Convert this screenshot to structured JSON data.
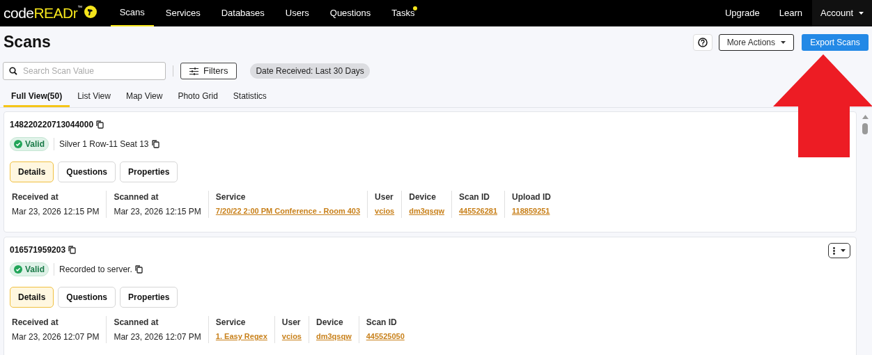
{
  "brand": {
    "name_plain": "code",
    "name_bold": "READr",
    "mark": "™"
  },
  "nav": [
    {
      "label": "Scans",
      "selected": true,
      "dot": false
    },
    {
      "label": "Services",
      "selected": false,
      "dot": false
    },
    {
      "label": "Databases",
      "selected": false,
      "dot": false
    },
    {
      "label": "Users",
      "selected": false,
      "dot": false
    },
    {
      "label": "Questions",
      "selected": false,
      "dot": false
    },
    {
      "label": "Tasks",
      "selected": false,
      "dot": true
    }
  ],
  "nav_right": [
    {
      "label": "Upgrade",
      "kind": "link"
    },
    {
      "label": "Learn",
      "kind": "link"
    },
    {
      "label": "Account",
      "kind": "menu"
    }
  ],
  "page_title": "Scans",
  "actions": {
    "more": "More Actions",
    "export": "Export Scans"
  },
  "search": {
    "placeholder": "Search Scan Value"
  },
  "filters_button": "Filters",
  "filter_chip": "Date Received: Last 30 Days",
  "view_tabs": [
    {
      "label": "Full View(50)",
      "selected": true
    },
    {
      "label": "List View",
      "selected": false
    },
    {
      "label": "Map View",
      "selected": false
    },
    {
      "label": "Photo Grid",
      "selected": false
    },
    {
      "label": "Statistics",
      "selected": false
    }
  ],
  "scans": [
    {
      "code": "148220220713044000",
      "status": "Valid",
      "value": "Silver 1 Row-11 Seat 13",
      "menu_visible": false,
      "tabs": [
        {
          "label": "Details",
          "selected": true
        },
        {
          "label": "Questions",
          "selected": false
        },
        {
          "label": "Properties",
          "selected": false
        }
      ],
      "fields": [
        {
          "label": "Received at",
          "value": "Mar 23, 2026 12:15 PM",
          "kind": "text"
        },
        {
          "label": "Scanned at",
          "value": "Mar 23, 2026 12:15 PM",
          "kind": "text"
        },
        {
          "label": "Service",
          "value": "7/20/22 2:00 PM Conference - Room 403",
          "kind": "link"
        },
        {
          "label": "User",
          "value": "vcios",
          "kind": "link"
        },
        {
          "label": "Device",
          "value": "dm3qsqw",
          "kind": "link"
        },
        {
          "label": "Scan ID",
          "value": "445526281",
          "kind": "link"
        },
        {
          "label": "Upload ID",
          "value": "118859251",
          "kind": "link"
        }
      ]
    },
    {
      "code": "016571959203",
      "status": "Valid",
      "value": "Recorded to server.",
      "menu_visible": true,
      "tabs": [
        {
          "label": "Details",
          "selected": true
        },
        {
          "label": "Questions",
          "selected": false
        },
        {
          "label": "Properties",
          "selected": false
        }
      ],
      "fields": [
        {
          "label": "Received at",
          "value": "Mar 23, 2026 12:07 PM",
          "kind": "text"
        },
        {
          "label": "Scanned at",
          "value": "Mar 23, 2026 12:07 PM",
          "kind": "text"
        },
        {
          "label": "Service",
          "value": "1. Easy Regex",
          "kind": "link"
        },
        {
          "label": "User",
          "value": "vcios",
          "kind": "link"
        },
        {
          "label": "Device",
          "value": "dm3qsqw",
          "kind": "link"
        },
        {
          "label": "Scan ID",
          "value": "445525050",
          "kind": "link"
        }
      ]
    }
  ]
}
